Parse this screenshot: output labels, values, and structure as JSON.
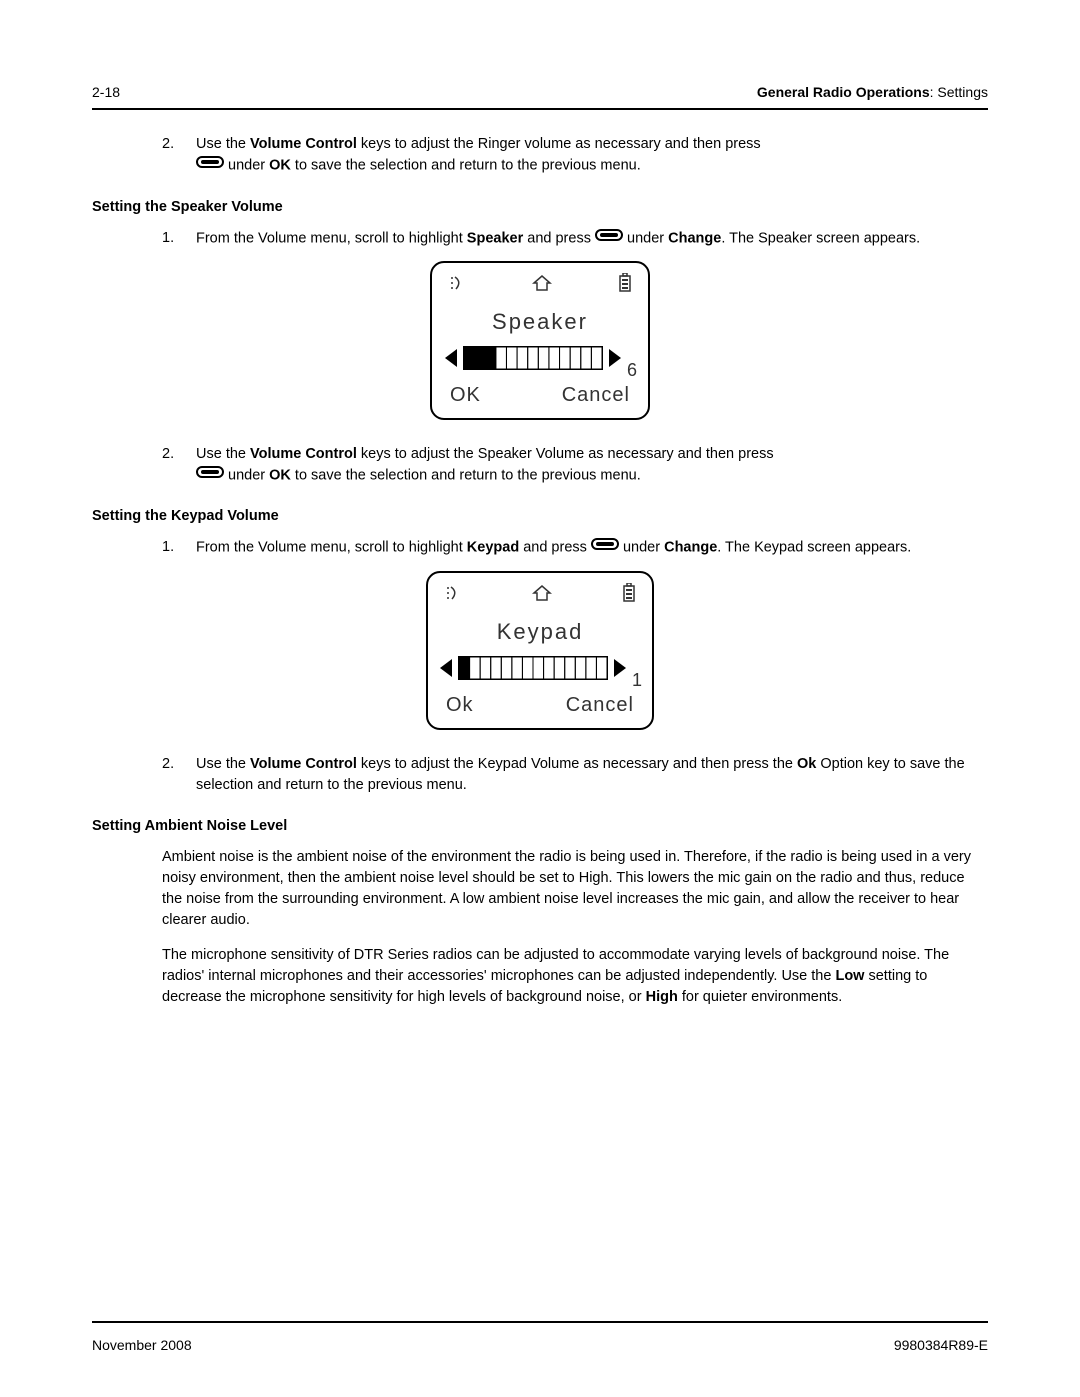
{
  "header": {
    "page_num": "2-18",
    "section_bold": "General Radio Operations",
    "section_plain": ": Settings"
  },
  "footer": {
    "date": "November 2008",
    "doc_id": "9980384R89-E"
  },
  "step_a2": {
    "num": "2.",
    "p1_a": "Use the ",
    "p1_b": "Volume Control",
    "p1_c": " keys to adjust the Ringer volume as necessary and then press ",
    "p2_a": " under ",
    "p2_b": "OK",
    "p2_c": " to save the selection and return to the previous menu."
  },
  "heading_speaker": "Setting the Speaker Volume",
  "step_b1": {
    "num": "1.",
    "a": "From the Volume menu, scroll to highlight ",
    "b": "Speaker",
    "c": " and press ",
    "d": " under ",
    "e": "Change",
    "f": ". The Speaker screen appears."
  },
  "lcd_speaker": {
    "title": "Speaker",
    "level": "6",
    "filled": 3,
    "total": 13,
    "ok": "OK",
    "cancel": "Cancel"
  },
  "step_b2": {
    "num": "2.",
    "p1_a": "Use the ",
    "p1_b": "Volume Control",
    "p1_c": " keys to adjust the Speaker Volume as necessary and then press ",
    "p2_a": " under ",
    "p2_b": "OK",
    "p2_c": " to save the selection and return to the previous menu."
  },
  "heading_keypad": "Setting the Keypad Volume",
  "step_c1": {
    "num": "1.",
    "a": "From the Volume menu, scroll to highlight ",
    "b": "Keypad",
    "c": " and press ",
    "d": " under ",
    "e": "Change",
    "f": ". The Keypad screen appears."
  },
  "lcd_keypad": {
    "title": "Keypad",
    "level": "1",
    "filled": 1,
    "total": 14,
    "ok": "Ok",
    "cancel": "Cancel"
  },
  "step_c2": {
    "num": "2.",
    "a": "Use the ",
    "b": "Volume Control",
    "c": " keys to adjust the Keypad Volume as necessary and then press the ",
    "d": "Ok",
    "e": " Option key to save the selection and return to the previous menu."
  },
  "heading_ambient": "Setting Ambient Noise Level",
  "ambient_p1": "Ambient noise is the ambient noise of the environment the radio is being used in. Therefore, if the radio is being used in a very noisy environment, then the ambient noise level should be set to High. This lowers the mic gain on the radio and thus, reduce the noise from the surrounding environment. A low ambient noise level increases the mic gain, and allow the receiver to hear clearer audio.",
  "ambient_p2": {
    "a": "The microphone sensitivity of DTR Series radios can be adjusted to accommodate varying levels of background noise. The radios' internal microphones and their accessories' microphones can be adjusted independently. Use the ",
    "b": "Low",
    "c": " setting to decrease the microphone sensitivity for high levels of background noise, or ",
    "d": "High",
    "e": " for quieter environments."
  }
}
